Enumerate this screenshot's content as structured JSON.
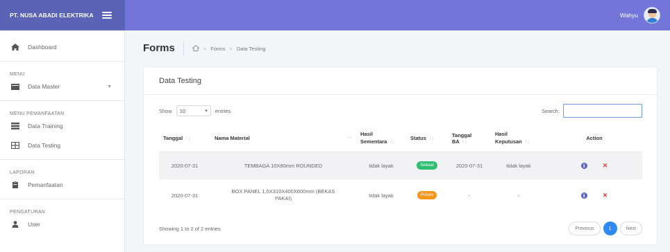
{
  "app": {
    "brand": "PT. NUSA ABADI ELEKTRIKA",
    "user_name": "Wahyu"
  },
  "sidebar": {
    "dashboard": "Dashboard",
    "menu_heading": "MENU",
    "data_master": "Data Master",
    "pemanfaatan_heading": "MENU PEMANFAATAN",
    "data_training": "Data Training",
    "data_testing": "Data Testing",
    "laporan_heading": "LAPORAN",
    "pemanfaatan": "Pemanfaatan",
    "pengaturan_heading": "PENGATURAN",
    "user": "User"
  },
  "header": {
    "title": "Forms",
    "breadcrumb": [
      "Forms",
      "Data Testing"
    ]
  },
  "card": {
    "title": "Data Testing"
  },
  "toolbar": {
    "show_label": "Show",
    "entries_value": "10",
    "entries_label": "entries",
    "search_label": "Search:",
    "search_value": ""
  },
  "table": {
    "headers": {
      "tanggal": "Tanggal",
      "nama_material": "Nama Material",
      "hasil_sementara_1": "Hasil",
      "hasil_sementara_2": "Sementara",
      "status": "Status",
      "tanggal_ba": "Tanggal BA",
      "hasil_keputusan_1": "Hasil",
      "hasil_keputusan_2": "Keputusan",
      "action": "Action"
    },
    "rows": [
      {
        "tanggal": "2020-07-31",
        "nama_material": "TEMBAGA 10X80mm ROUNDED",
        "hasil_sementara": "tidak layak",
        "status": "Selesai",
        "status_color": "#2fbf71",
        "tanggal_ba": "2020-07-31",
        "hasil_keputusan": "tidak layak"
      },
      {
        "tanggal": "2020-07-31",
        "nama_material": "BOX PANEL 1,5X310X400X600mm (BEKAS PAKAI)",
        "hasil_sementara": "tidak layak",
        "status": "Proses",
        "status_color": "#f7941d",
        "tanggal_ba": "-",
        "hasil_keputusan": "-"
      }
    ]
  },
  "footer": {
    "info": "Showing 1 to 2 of 2 entries",
    "previous": "Previous",
    "page": "1",
    "next": "Next"
  },
  "colors": {
    "sidebar_brand": "#5b63b7",
    "navbar": "#7376d8",
    "accent": "#2f8af5"
  }
}
